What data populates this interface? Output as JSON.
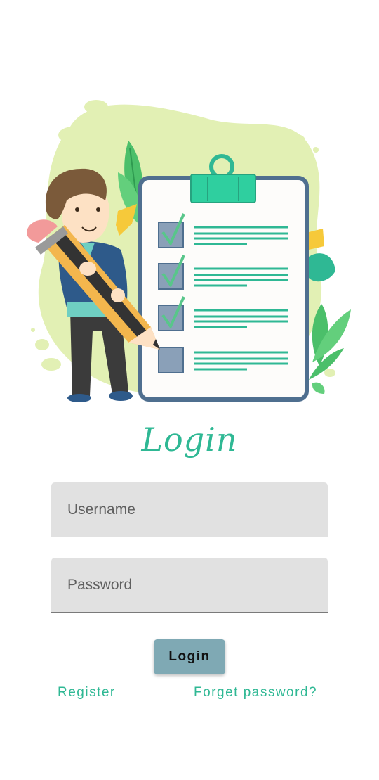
{
  "illustration": {
    "icon": "person-with-pencil-and-checklist-illustration",
    "colors": {
      "blob": "#e2f0b4",
      "accent_green": "#2fb894",
      "clipboard_border": "#4f6f8f",
      "checkbox": "#8aa0b8",
      "checkmark": "#58c68a"
    }
  },
  "title": "Login",
  "username": {
    "placeholder": "Username",
    "value": ""
  },
  "password": {
    "placeholder": "Password",
    "value": ""
  },
  "login_button": {
    "label": "Login",
    "color": "#7fa9b4"
  },
  "links": {
    "register": "Register",
    "forgot": "Forget password?",
    "color": "#2fb894"
  }
}
